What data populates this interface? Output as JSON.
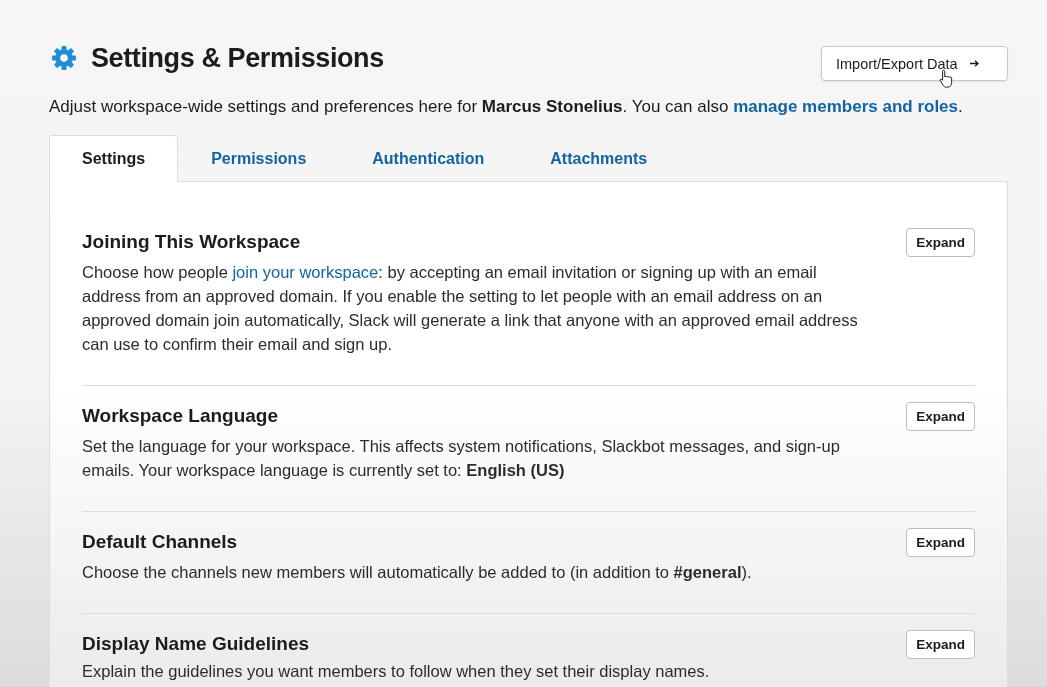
{
  "header": {
    "title": "Settings & Permissions",
    "action_button": "Import/Export Data"
  },
  "intro": [
    {
      "kind": "text",
      "text": "Adjust workspace-wide settings and preferences here for **Marcus Stonelius**. You can also "
    },
    {
      "kind": "link",
      "text": "manage members and roles"
    },
    {
      "kind": "text",
      "text": "."
    }
  ],
  "tabs": [
    {
      "label": "Settings",
      "selected": true
    },
    {
      "label": "Permissions",
      "selected": false
    },
    {
      "label": "Authentication",
      "selected": false
    },
    {
      "label": "Attachments",
      "selected": false
    }
  ],
  "sections": [
    {
      "title": "Joining This Workspace",
      "button": "Expand",
      "description": [
        {
          "kind": "text",
          "text": "Choose how people "
        },
        {
          "kind": "link",
          "text": "join your workspace"
        },
        {
          "kind": "text",
          "text": ": by accepting an email invitation or signing up with an email address from an approved domain. If you enable the setting to let people with an email address on an approved domain join automatically, Slack will generate a link that anyone with an approved email address can use to confirm their email and sign up."
        }
      ]
    },
    {
      "title": "Workspace Language",
      "button": "Expand",
      "description": [
        {
          "kind": "text",
          "text": "Set the language for your workspace. This affects system notifications, Slackbot messages, and sign-up emails. Your workspace language is currently set to: **English (US)**"
        }
      ]
    },
    {
      "title": "Default Channels",
      "button": "Expand",
      "description": [
        {
          "kind": "text",
          "text": "Choose the channels new members will automatically be added to (in addition to **#general**)."
        }
      ]
    },
    {
      "title": "Display Name Guidelines",
      "button": "Expand",
      "description": [
        {
          "kind": "text",
          "text": "Explain the guidelines you want members to follow when they set their display names."
        }
      ]
    }
  ]
}
